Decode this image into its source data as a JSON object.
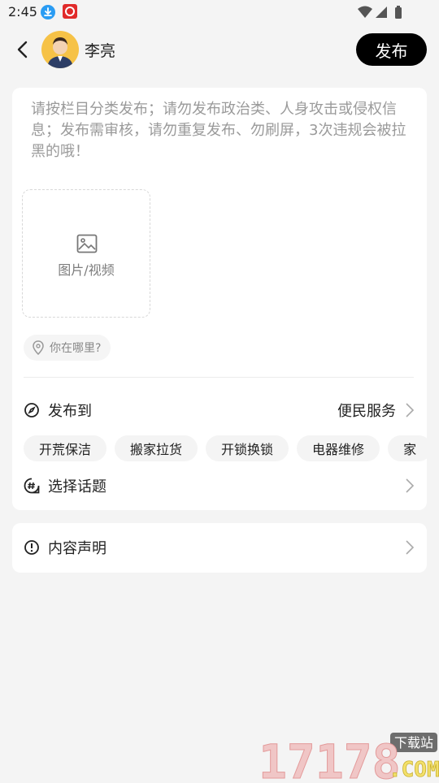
{
  "status_bar": {
    "time": "2:45"
  },
  "header": {
    "username": "李亮",
    "publish_label": "发布"
  },
  "editor": {
    "placeholder": "请按栏目分类发布；请勿发布政治类、人身攻击或侵权信息；发布需审核，请勿重复发布、勿刷屏，3次违规会被拉黑的哦！",
    "upload_label": "图片/视频",
    "location_placeholder": "你在哪里?"
  },
  "publish_to": {
    "label": "发布到",
    "value": "便民服务",
    "chips": [
      "开荒保洁",
      "搬家拉货",
      "开锁换锁",
      "电器维修",
      "家"
    ]
  },
  "topic": {
    "label": "选择话题"
  },
  "declaration": {
    "label": "内容声明"
  },
  "watermark": {
    "badge": "下载站",
    "text": "17178.COM"
  },
  "colors": {
    "accent": "#000000",
    "card": "#ffffff",
    "background": "#f4f4f4",
    "placeholder": "#9a9a9a"
  }
}
